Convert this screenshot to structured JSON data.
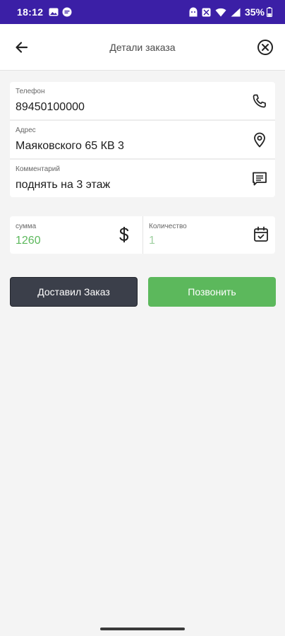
{
  "statusbar": {
    "time": "18:12",
    "battery": "35%",
    "icons": [
      "gallery-icon",
      "chat-icon",
      "face-icon",
      "alarm-icon",
      "wifi-icon",
      "signal-icon",
      "battery-icon"
    ]
  },
  "appbar": {
    "title": "Детали заказа",
    "back_icon": "arrow-left-icon",
    "close_icon": "close-circle-icon"
  },
  "fields": {
    "phone": {
      "label": "Телефон",
      "value": "89450100000",
      "icon": "phone-icon"
    },
    "address": {
      "label": "Адрес",
      "value": "Маяковского 65 КВ 3",
      "icon": "location-pin-icon"
    },
    "comment": {
      "label": "Комментарий",
      "value": "поднять на 3 этаж",
      "icon": "message-icon"
    }
  },
  "summary": {
    "sum": {
      "label": "сумма",
      "value": "1260",
      "icon": "dollar-icon"
    },
    "quantity": {
      "label": "Количество",
      "value": "1",
      "icon": "calendar-check-icon"
    }
  },
  "actions": {
    "delivered_label": "Доставил Заказ",
    "call_label": "Позвонить"
  },
  "colors": {
    "statusbar": "#3b1fa6",
    "accent_green": "#5cb85c",
    "dark_button": "#3b3f4a"
  }
}
